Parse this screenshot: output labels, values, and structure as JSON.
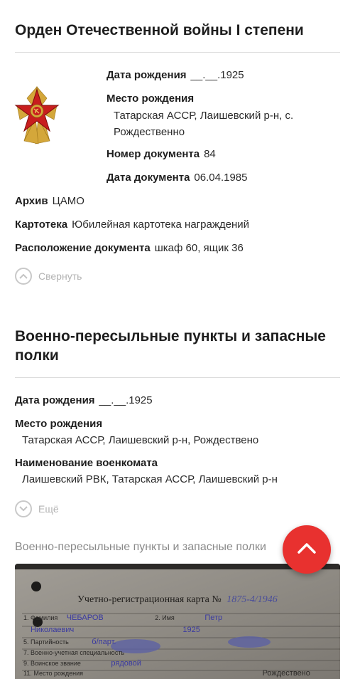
{
  "award": {
    "title": "Орден Отечественной войны I степени",
    "fields": {
      "birth_date_label": "Дата рождения",
      "birth_date": "__.__.1925",
      "birth_place_label": "Место рождения",
      "birth_place_line1": "Татарская АССР, Лаишевский р-н, с.",
      "birth_place_line2": "Рождественно",
      "doc_number_label": "Номер документа",
      "doc_number": "84",
      "doc_date_label": "Дата документа",
      "doc_date": "06.04.1985",
      "archive_label": "Архив",
      "archive": "ЦАМО",
      "card_index_label": "Картотека",
      "card_index": "Юбилейная картотека награждений",
      "location_label": "Расположение документа",
      "location": "шкаф 60, ящик 36"
    },
    "collapse_label": "Свернуть",
    "icon": "order-star-icon"
  },
  "transit": {
    "title_line1": "Военно-пересыльные пункты и запасные",
    "title_line2": "полки",
    "fields": {
      "birth_date_label": "Дата рождения",
      "birth_date": "__.__.1925",
      "birth_place_label": "Место рождения",
      "birth_place": "Татарская АССР, Лаишевский р-н, Рождествено",
      "commissariat_label": "Наименование военкомата",
      "commissariat": "Лаишевский РВК, Татарская АССР, Лаишевский р-н"
    },
    "more_label": "Ещё",
    "doc_caption": "Военно-пересыльные пункты и запасные полки",
    "scan": {
      "card_title": "Учетно-регистрационная карта №",
      "card_number": "1875-4/1946",
      "line1_label": "1. Фамилия",
      "line1_value": "ЧЕБАРОВ",
      "line1b_label": "2. Имя",
      "line1b_value": "Петр",
      "line2_value": "Николаевич",
      "line2b_value": "1925",
      "line3_label": "5. Партийность",
      "line3_value": "б/парт.",
      "line4_label": "7. Военно-учетная специальность",
      "line5_label": "9. Воинское звание",
      "line5_value": "рядовой",
      "line6_label": "11. Место рождения",
      "line6_value": "Рождествено"
    }
  },
  "colors": {
    "accent": "#e8312f",
    "muted": "#b3b3b3",
    "divider": "#dcdcdc"
  },
  "scroll_top_icon": "chevron-up-icon"
}
